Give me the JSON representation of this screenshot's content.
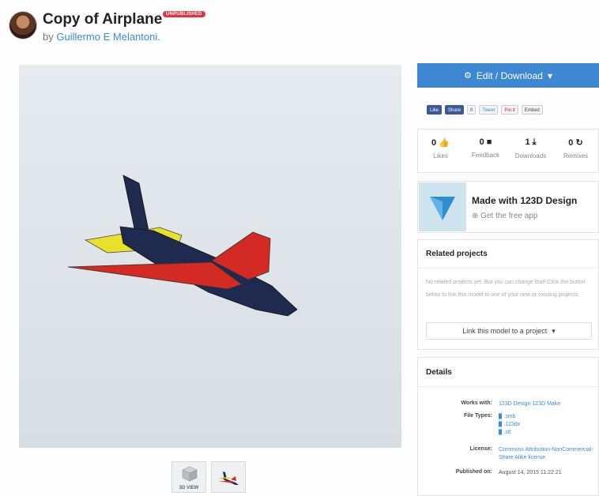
{
  "header": {
    "title": "Copy of Airplane",
    "badge": "UNPUBLISHED",
    "by_prefix": "by",
    "author": "Guillermo E Melantoni."
  },
  "viewer": {
    "thumb_3d_label": "3D VIEW"
  },
  "actions": {
    "edit_download_label": "Edit / Download",
    "caret": "▾"
  },
  "social": {
    "like": "Like",
    "share": "Share",
    "share_count": "0",
    "tweet": "Tweet",
    "pinit": "Pin it",
    "embed": "Embed"
  },
  "stats": [
    {
      "value": "0",
      "icon": "👍",
      "label": "Likes"
    },
    {
      "value": "0",
      "icon": "■",
      "label": "Feedback"
    },
    {
      "value": "1",
      "icon": "⤓",
      "label": "Downloads"
    },
    {
      "value": "0",
      "icon": "↻",
      "label": "Remixes"
    }
  ],
  "made_with": {
    "title": "Made with 123D Design",
    "link": "Get the free app"
  },
  "related": {
    "heading": "Related projects",
    "text": "No related projects yet. But you can change that! Click the button below to link this model to one of your new or existing projects.",
    "button": "Link this model to a project"
  },
  "details": {
    "heading": "Details",
    "works_with_label": "Works with:",
    "works_with": "123D Design 123D Make",
    "file_types_label": "File Types:",
    "file_types": [
      ".smb",
      ".123dx",
      ".stl"
    ],
    "license_label": "License:",
    "license": "Commons Attribution-NonCommercial-Share Alike license",
    "published_label": "Published on:",
    "published": "August 14, 2015 11:22:21"
  },
  "colors": {
    "accent": "#3d87d3",
    "badge": "#d9363e",
    "plane_body": "#1f2a4f",
    "plane_red": "#d42a24",
    "plane_yellow": "#e8e02a"
  }
}
